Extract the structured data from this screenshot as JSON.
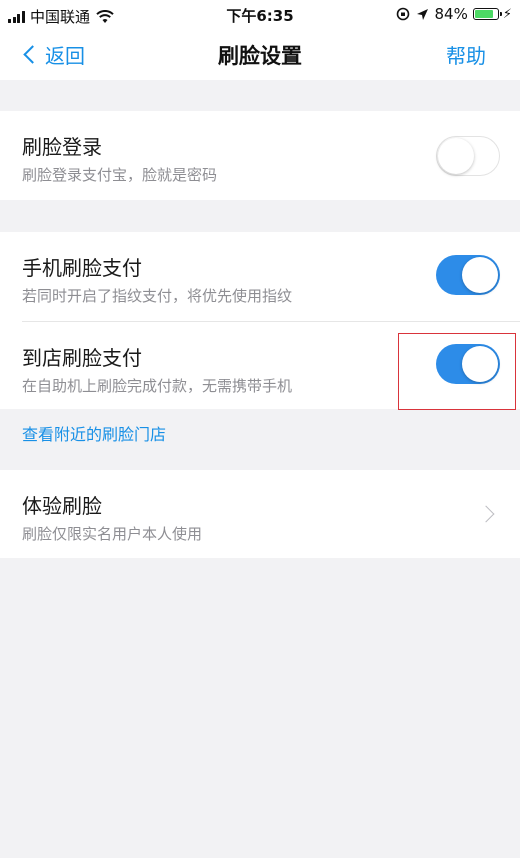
{
  "status_bar": {
    "carrier": "中国联通",
    "time": "下午6:35",
    "battery_percent": "84%",
    "battery_level": 0.84,
    "icons": [
      "signal-icon",
      "wifi-icon",
      "orientation-lock-icon",
      "location-icon",
      "battery-icon",
      "charging-icon"
    ]
  },
  "nav": {
    "back_label": "返回",
    "title": "刷脸设置",
    "help_label": "帮助"
  },
  "settings": {
    "face_login": {
      "title": "刷脸登录",
      "subtitle": "刷脸登录支付宝，脸就是密码",
      "enabled": false
    },
    "phone_face_pay": {
      "title": "手机刷脸支付",
      "subtitle": "若同时开启了指纹支付，将优先使用指纹",
      "enabled": true
    },
    "store_face_pay": {
      "title": "到店刷脸支付",
      "subtitle": "在自助机上刷脸完成付款，无需携带手机",
      "enabled": true
    },
    "nearby_link": "查看附近的刷脸门店",
    "try_face": {
      "title": "体验刷脸",
      "subtitle": "刷脸仅限实名用户本人使用"
    }
  },
  "colors": {
    "accent": "#1890e6",
    "toggle_on": "#2d8ce8",
    "background": "#f2f2f4",
    "highlight": "#d9343b"
  }
}
